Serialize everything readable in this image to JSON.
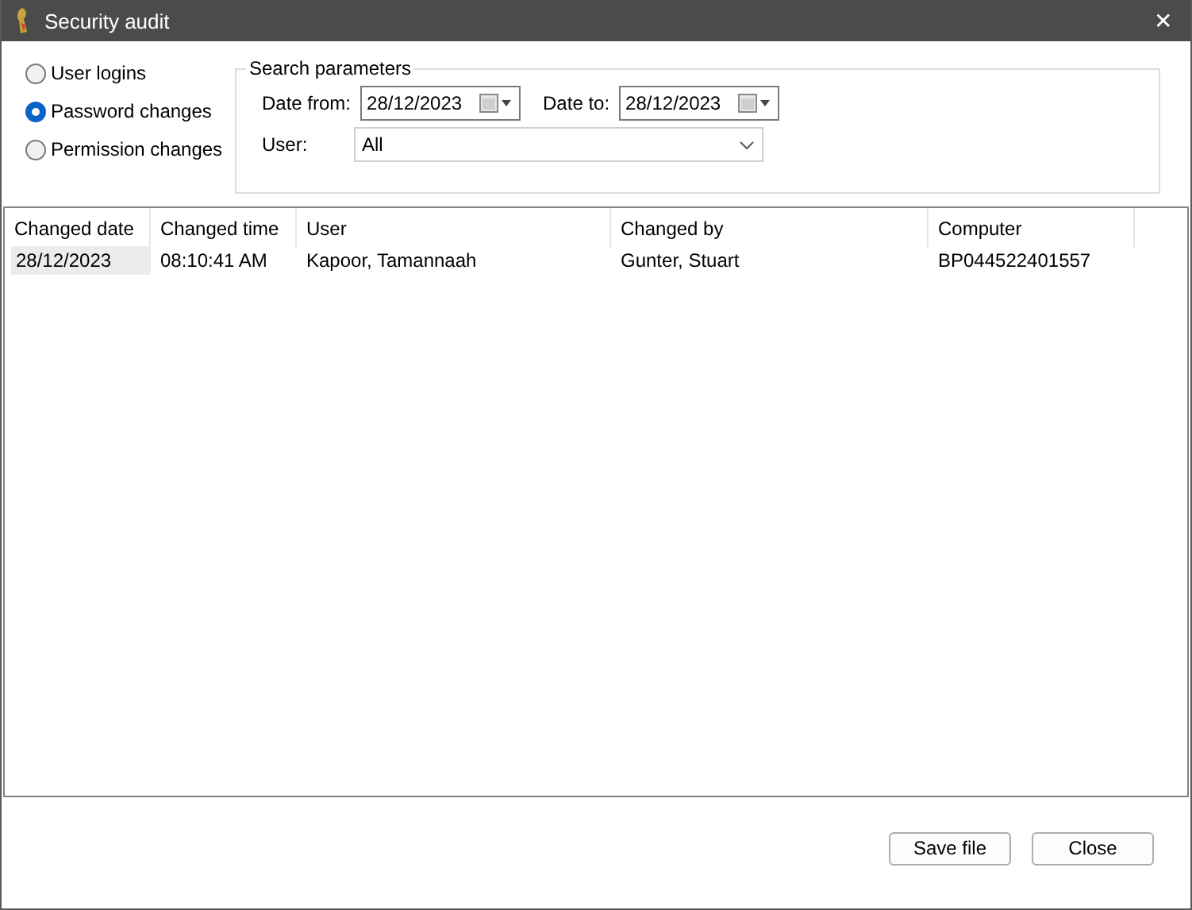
{
  "window": {
    "title": "Security audit",
    "close": "✕"
  },
  "report_types": [
    {
      "label": "User logins",
      "selected": false
    },
    {
      "label": "Password changes",
      "selected": true
    },
    {
      "label": "Permission changes",
      "selected": false
    }
  ],
  "search_parameters": {
    "title": "Search parameters",
    "date_from": {
      "label": "Date from:",
      "value": "28/12/2023"
    },
    "date_to": {
      "label": "Date to:",
      "value": "28/12/2023"
    },
    "user": {
      "label": "User:",
      "value": "All"
    }
  },
  "table": {
    "columns": [
      "Changed date",
      "Changed time",
      "User",
      "Changed by",
      "Computer"
    ],
    "rows": [
      {
        "selected": true,
        "cells": [
          "28/12/2023",
          "08:10:41 AM",
          "Kapoor, Tamannaah",
          "Gunter, Stuart",
          "BP044522401557"
        ]
      }
    ]
  },
  "buttons": [
    "Save file",
    "Close"
  ]
}
